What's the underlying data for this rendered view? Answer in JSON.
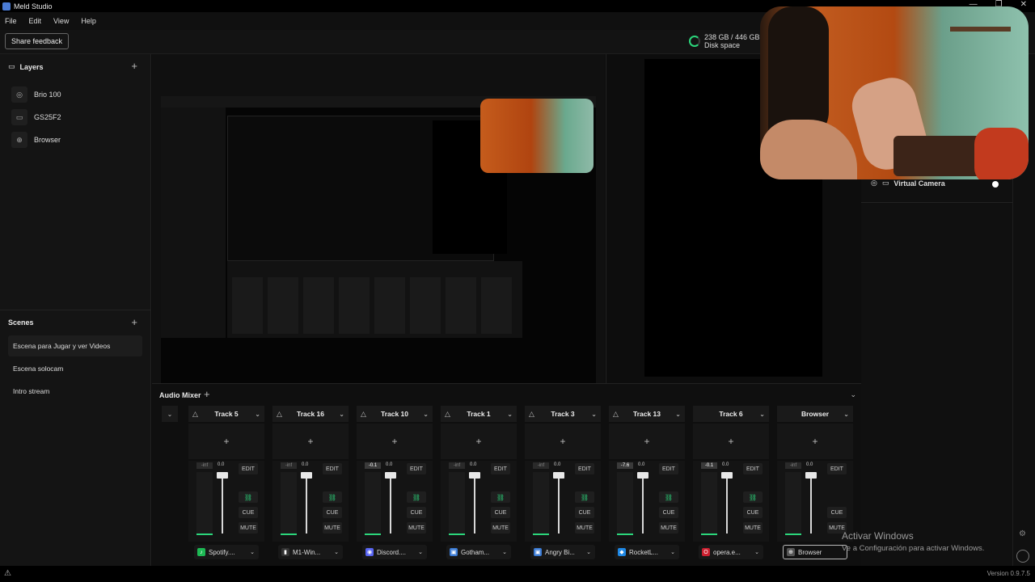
{
  "window": {
    "title": "Meld Studio",
    "controls": [
      "—",
      "❐",
      "✕"
    ]
  },
  "menu": [
    "File",
    "Edit",
    "View",
    "Help"
  ],
  "topbar": {
    "feedback_label": "Share feedback",
    "disk_line1": "238 GB / 446 GB",
    "disk_line2": "Disk space"
  },
  "layers": {
    "title": "Layers",
    "items": [
      {
        "label": "Brio 100",
        "icon": "camera-icon"
      },
      {
        "label": "GS25F2",
        "icon": "monitor-icon"
      },
      {
        "label": "Browser",
        "icon": "globe-icon"
      }
    ]
  },
  "scenes": {
    "title": "Scenes",
    "items": [
      "Escena para Jugar y ver Videos",
      "Escena solocam",
      "Intro stream"
    ],
    "active_index": 0
  },
  "right_panel": {
    "virtual_camera_label": "Virtual Camera"
  },
  "mixer": {
    "title": "Audio Mixer",
    "edit_label": "EDIT",
    "cue_label": "CUE",
    "mute_label": "MUTE",
    "tracks": [
      {
        "name": "Track 5",
        "peak": "-inf",
        "db": "0.0",
        "source": "Spotify....",
        "src_color": "#1db954",
        "src_glyph": "♪",
        "link": true
      },
      {
        "name": "Track 16",
        "peak": "-inf",
        "db": "0.0",
        "source": "M1-Win...",
        "src_color": "#333333",
        "src_glyph": "▮",
        "link": true
      },
      {
        "name": "Track 10",
        "peak": "-0.1",
        "db": "0.0",
        "source": "Discord....",
        "src_color": "#5865f2",
        "src_glyph": "◉",
        "link": true
      },
      {
        "name": "Track 1",
        "peak": "-inf",
        "db": "0.0",
        "source": "Gotham...",
        "src_color": "#3b7bd4",
        "src_glyph": "▣",
        "link": true
      },
      {
        "name": "Track 3",
        "peak": "-inf",
        "db": "0.0",
        "source": "Angry Bi...",
        "src_color": "#3b7bd4",
        "src_glyph": "▣",
        "link": true
      },
      {
        "name": "Track 13",
        "peak": "-7.6",
        "db": "0.0",
        "source": "RocketL...",
        "src_color": "#1e88e5",
        "src_glyph": "◆",
        "link": true
      },
      {
        "name": "Track 6",
        "peak": "-0.1",
        "db": "0.0",
        "source": "opera.e...",
        "src_color": "#cc1f2f",
        "src_glyph": "O",
        "link": true
      },
      {
        "name": "Browser",
        "peak": "-inf",
        "db": "0.0",
        "source": "Browser",
        "src_color": "#555555",
        "src_glyph": "⊕",
        "link": false
      }
    ]
  },
  "activation": {
    "line1": "Activar Windows",
    "line2": "Ve a Configuración para activar Windows."
  },
  "status": {
    "version": "Version 0.9.7.5"
  }
}
